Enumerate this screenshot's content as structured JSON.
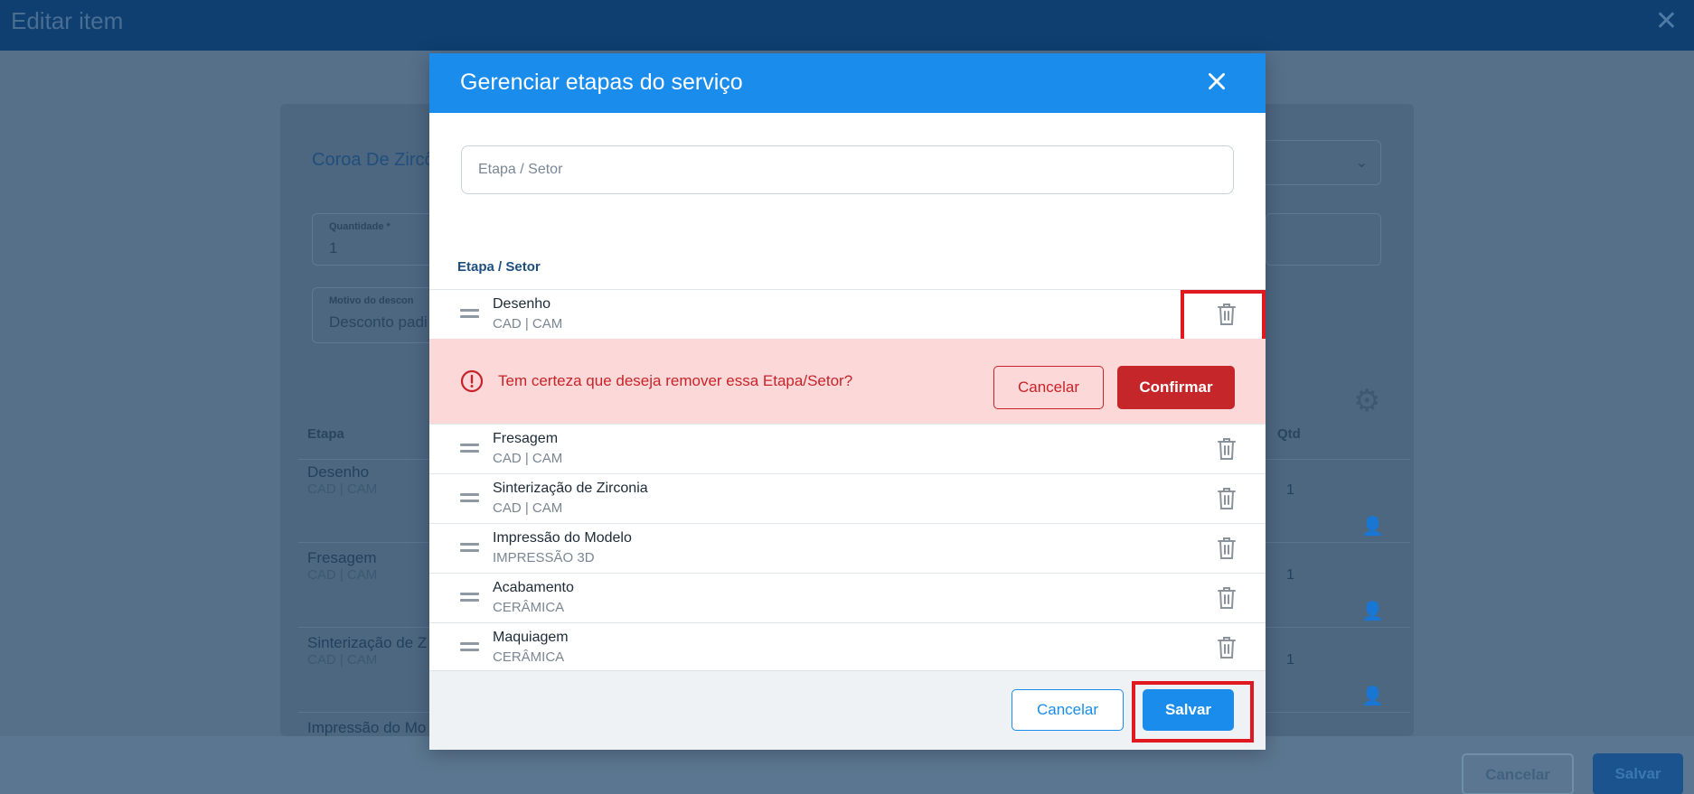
{
  "background": {
    "window_title": "Editar item",
    "product_name": "Coroa De Zircô",
    "quantity_field": {
      "label": "Quantidade *",
      "value": "1"
    },
    "discount_field": {
      "label": "Motivo do descon",
      "value": "Desconto padi"
    },
    "table_headers": {
      "etapa": "Etapa",
      "qtd": "Qtd"
    },
    "rows": [
      {
        "name": "Desenho",
        "sub": "CAD | CAM",
        "qty": "1"
      },
      {
        "name": "Fresagem",
        "sub": "CAD | CAM",
        "qty": "1"
      },
      {
        "name": "Sinterização de Z",
        "sub": "CAD | CAM",
        "qty": "1"
      },
      {
        "name": "Impressão do Mo",
        "sub": "",
        "qty": ""
      }
    ],
    "footer": {
      "cancel_label": "Cancelar",
      "save_label": "Salvar"
    }
  },
  "modal": {
    "title": "Gerenciar etapas do serviço",
    "search_placeholder": "Etapa / Setor",
    "column_header": "Etapa / Setor",
    "items": [
      {
        "name": "Desenho",
        "sector": "CAD | CAM"
      },
      {
        "name": "Fresagem",
        "sector": "CAD | CAM"
      },
      {
        "name": "Sinterização de Zirconia",
        "sector": "CAD | CAM"
      },
      {
        "name": "Impressão do Modelo",
        "sector": "IMPRESSÃO 3D"
      },
      {
        "name": "Acabamento",
        "sector": "CERÂMICA"
      },
      {
        "name": "Maquiagem",
        "sector": "CERÂMICA"
      }
    ],
    "confirm": {
      "message": "Tem certeza que deseja remover essa Etapa/Setor?",
      "cancel_label": "Cancelar",
      "confirm_label": "Confirmar"
    },
    "footer": {
      "cancel_label": "Cancelar",
      "save_label": "Salvar"
    }
  },
  "colors": {
    "primary": "#1a8cec",
    "danger": "#c4262a",
    "danger_bg": "#fdd8d8",
    "highlight": "#e0181f"
  }
}
